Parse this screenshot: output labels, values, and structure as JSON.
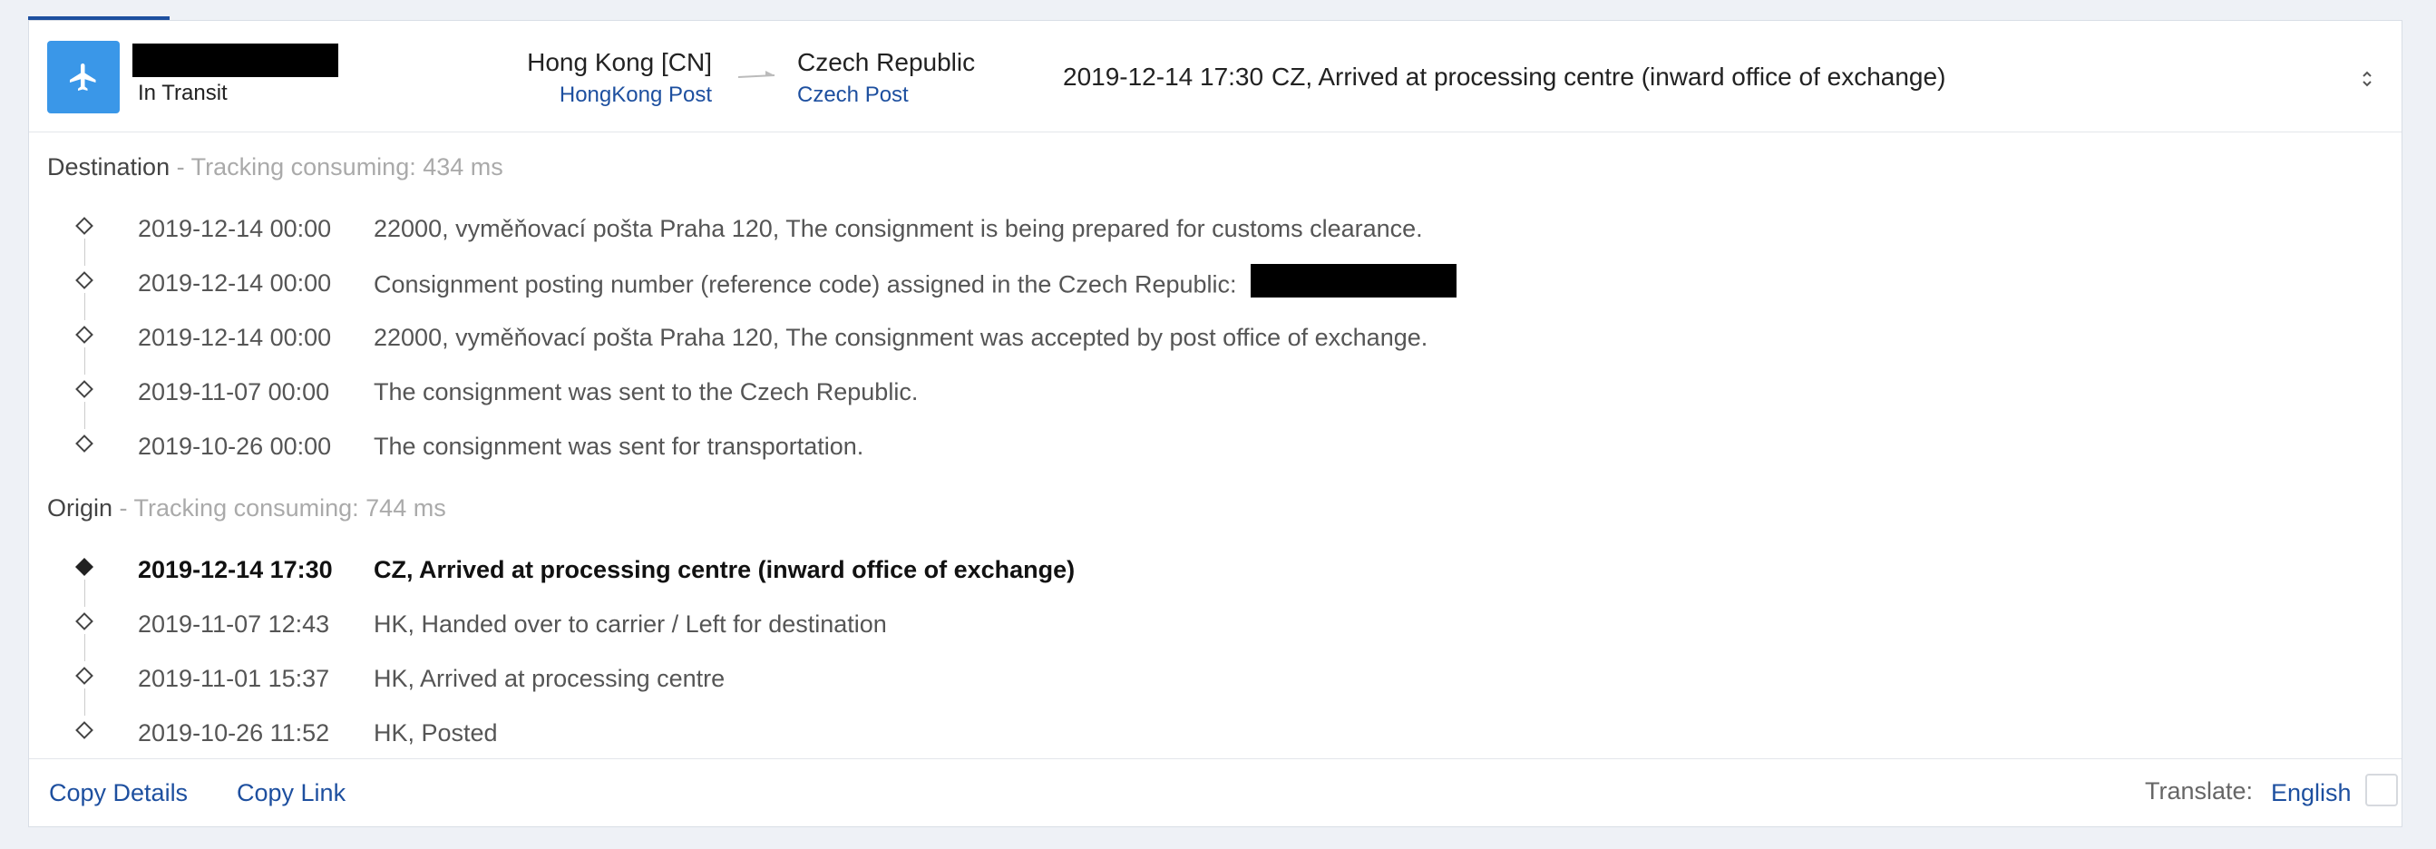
{
  "shipment": {
    "status": "In Transit",
    "status_icon": "airplane-icon",
    "origin_country": "Hong Kong [CN]",
    "origin_carrier": "HongKong Post",
    "destination_country": "Czech Republic",
    "destination_carrier": "Czech Post",
    "latest_time": "2019-12-14 17:30",
    "latest_desc": "CZ, Arrived at processing centre (inward office of exchange)"
  },
  "destination": {
    "title": "Destination",
    "consuming": "- Tracking consuming: 434 ms",
    "events": [
      {
        "time": "2019-12-14 00:00",
        "desc": "22000, vyměňovací pošta Praha 120, The consignment is being prepared for customs clearance."
      },
      {
        "time": "2019-12-14 00:00",
        "desc": "Consignment posting number (reference code) assigned in the Czech Republic:"
      },
      {
        "time": "2019-12-14 00:00",
        "desc": "22000, vyměňovací pošta Praha 120, The consignment was accepted by post office of exchange."
      },
      {
        "time": "2019-11-07 00:00",
        "desc": "The consignment was sent to the Czech Republic."
      },
      {
        "time": "2019-10-26 00:00",
        "desc": "The consignment was sent for transportation."
      }
    ]
  },
  "origin": {
    "title": "Origin",
    "consuming": "- Tracking consuming: 744 ms",
    "events": [
      {
        "time": "2019-12-14 17:30",
        "desc": "CZ, Arrived at processing centre (inward office of exchange)"
      },
      {
        "time": "2019-11-07 12:43",
        "desc": "HK, Handed over to carrier / Left for destination"
      },
      {
        "time": "2019-11-01 15:37",
        "desc": "HK, Arrived at processing centre"
      },
      {
        "time": "2019-10-26 11:52",
        "desc": "HK, Posted"
      }
    ]
  },
  "footer": {
    "copy_details": "Copy Details",
    "copy_link": "Copy Link",
    "translate_label": "Translate:",
    "translate_lang": "English"
  },
  "colors": {
    "accent": "#1d4f9f",
    "status_icon_bg": "#3a97e8"
  }
}
